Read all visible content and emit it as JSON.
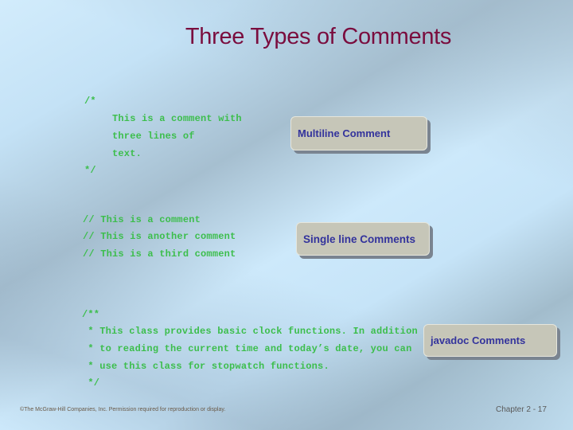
{
  "slide": {
    "title": "Three Types of Comments",
    "sections": [
      {
        "lines": [
          "/*",
          "    This is a comment with",
          "    three lines of",
          "    text.",
          "*/"
        ],
        "callout": "Multiline Comment"
      },
      {
        "lines": [
          "// This is a comment",
          "// This is another comment",
          "// This is a third comment"
        ],
        "callout": "Single line Comments"
      },
      {
        "lines": [
          "/**",
          " * This class provides basic clock functions. In addition",
          " * to reading the current time and today’s date, you can",
          " * use this class for stopwatch functions.",
          " */"
        ],
        "callout": "javadoc Comments"
      }
    ],
    "colors": {
      "title": "#7a0d3e",
      "code": "#3cbe4c",
      "callout_text": "#33339c",
      "callout_bg": "#c6c6b8"
    }
  },
  "footer": {
    "copyright": "©The McGraw-Hill Companies, Inc. Permission required for reproduction or display.",
    "page": "Chapter 2 -  17"
  }
}
